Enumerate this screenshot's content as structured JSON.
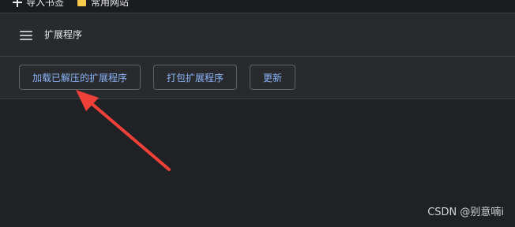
{
  "bookmarks": {
    "import_label": "导入书签",
    "folder_label": "常用网站"
  },
  "header": {
    "menu_icon": "hamburger-menu-icon",
    "title": "扩展程序"
  },
  "toolbar": {
    "load_unpacked_label": "加载已解压的扩展程序",
    "pack_label": "打包扩展程序",
    "update_label": "更新"
  },
  "annotation": {
    "arrow_color": "#f0403a"
  },
  "watermark": {
    "text": "CSDN @别意喃i"
  },
  "colors": {
    "background": "#202124",
    "toolbar": "#292a2d",
    "accent": "#8ab4f8",
    "border": "#5f6368"
  }
}
